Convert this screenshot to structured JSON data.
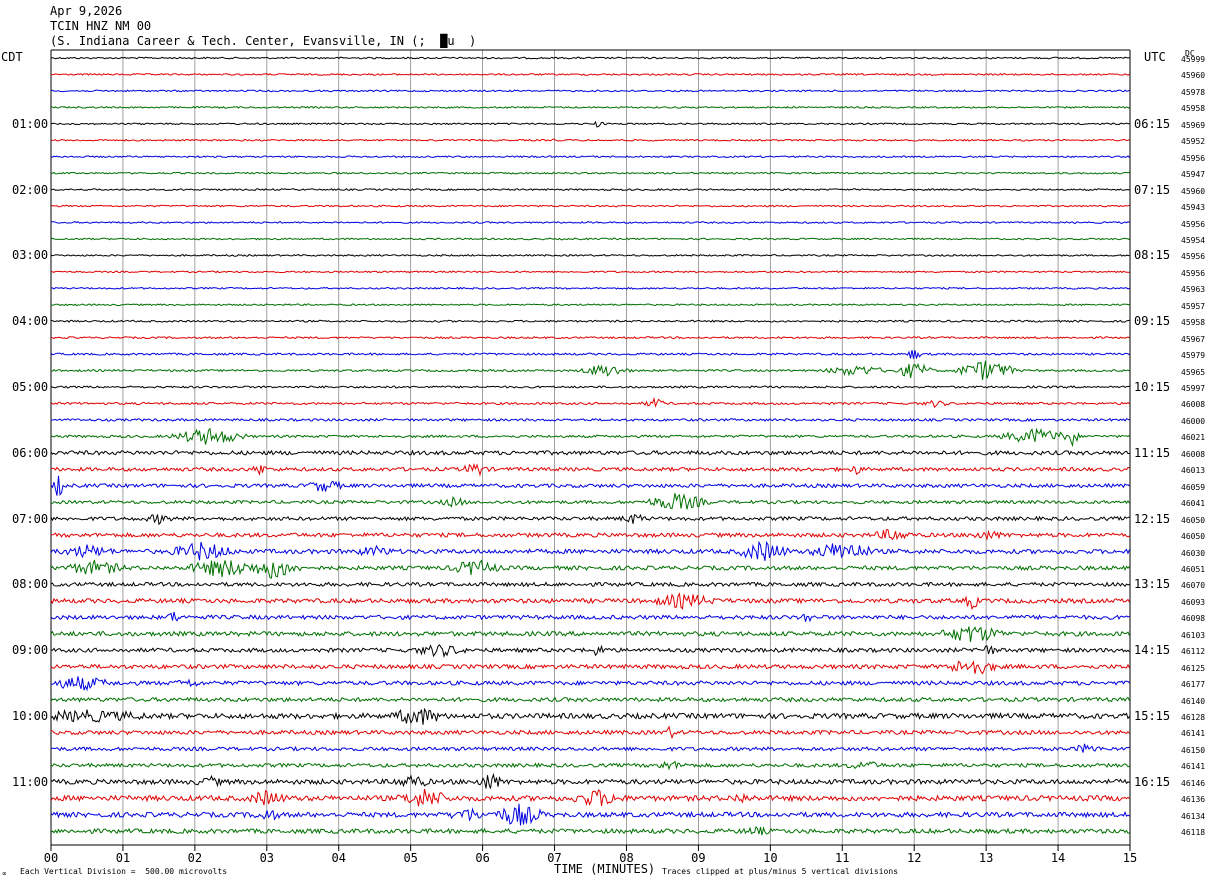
{
  "header": {
    "date": "Apr 9,2026",
    "station": "TCIN HNZ NM 00",
    "location": "(S. Indiana Career & Tech. Center, Evansville, IN (;  █u  )"
  },
  "left_axis_label": "CDT",
  "right_axis_label": "UTC",
  "dc_label": "DC",
  "footer": {
    "scale": "Each Vertical Division =  500.00 microvolts",
    "xlabel": "TIME (MINUTES)",
    "clip_note": "Traces clipped at plus/minus 5 vertical divisions",
    "corner_mark": "∝"
  },
  "chart_data": {
    "type": "line",
    "title": "",
    "xlabel": "TIME (MINUTES)",
    "xlim": [
      0,
      15
    ],
    "x_ticks": [
      "00",
      "01",
      "02",
      "03",
      "04",
      "05",
      "06",
      "07",
      "08",
      "09",
      "10",
      "11",
      "12",
      "13",
      "14",
      "15"
    ],
    "num_traces": 48,
    "trace_colors": [
      "#000000",
      "#e00000",
      "#0000e0",
      "#007000"
    ],
    "cdt_hour_labels": [
      "01:00",
      "02:00",
      "03:00",
      "04:00",
      "05:00",
      "06:00",
      "07:00",
      "08:00",
      "09:00",
      "10:00",
      "11:00"
    ],
    "utc_hour_labels": [
      "06:15",
      "07:15",
      "08:15",
      "09:15",
      "10:15",
      "11:15",
      "12:15",
      "13:15",
      "14:15",
      "15:15",
      "16:15"
    ],
    "dc_offsets": [
      45999,
      45960,
      45978,
      45958,
      45969,
      45952,
      45956,
      45947,
      45960,
      45943,
      45956,
      45954,
      45956,
      45956,
      45963,
      45957,
      45958,
      45967,
      45979,
      45965,
      45997,
      46008,
      46000,
      46021,
      46008,
      46013,
      46059,
      46041,
      46050,
      46050,
      46030,
      46051,
      46070,
      46093,
      46098,
      46103,
      46112,
      46125,
      46177,
      46140,
      46128,
      46141,
      46150,
      46141,
      46146,
      46136,
      46134,
      46118
    ],
    "trace_noise": [
      0.8,
      0.8,
      0.8,
      0.8,
      0.8,
      0.8,
      0.8,
      0.8,
      0.8,
      0.8,
      0.8,
      0.8,
      0.8,
      0.8,
      0.8,
      0.8,
      0.9,
      0.9,
      1.0,
      1.0,
      1.0,
      1.1,
      1.2,
      1.2,
      2.0,
      1.8,
      1.8,
      1.6,
      1.8,
      2.0,
      2.2,
      2.0,
      1.9,
      2.2,
      2.0,
      2.2,
      2.0,
      2.1,
      2.0,
      2.0,
      2.6,
      2.0,
      1.8,
      1.8,
      2.4,
      2.6,
      2.4,
      2.2
    ],
    "events": [
      {
        "trace": 4,
        "minute": 7.6,
        "amp": 3,
        "dur": 0.1
      },
      {
        "trace": 5,
        "minute": 7.0,
        "amp": 2,
        "dur": 0.05
      },
      {
        "trace": 18,
        "minute": 12.0,
        "amp": 7,
        "dur": 0.1
      },
      {
        "trace": 19,
        "minute": 7.7,
        "amp": 6,
        "dur": 0.4
      },
      {
        "trace": 19,
        "minute": 11.2,
        "amp": 5,
        "dur": 0.5
      },
      {
        "trace": 19,
        "minute": 12.0,
        "amp": 8,
        "dur": 0.3
      },
      {
        "trace": 19,
        "minute": 13.0,
        "amp": 10,
        "dur": 0.5
      },
      {
        "trace": 21,
        "minute": 8.4,
        "amp": 4,
        "dur": 0.2
      },
      {
        "trace": 21,
        "minute": 12.3,
        "amp": 3,
        "dur": 0.2
      },
      {
        "trace": 23,
        "minute": 2.2,
        "amp": 8,
        "dur": 0.6
      },
      {
        "trace": 23,
        "minute": 13.7,
        "amp": 7,
        "dur": 0.6
      },
      {
        "trace": 23,
        "minute": 14.2,
        "amp": 10,
        "dur": 0.1
      },
      {
        "trace": 25,
        "minute": 2.9,
        "amp": 6,
        "dur": 0.1
      },
      {
        "trace": 25,
        "minute": 5.9,
        "amp": 6,
        "dur": 0.2
      },
      {
        "trace": 25,
        "minute": 11.2,
        "amp": 4,
        "dur": 0.1
      },
      {
        "trace": 26,
        "minute": 0.1,
        "amp": 10,
        "dur": 0.1
      },
      {
        "trace": 26,
        "minute": 3.8,
        "amp": 5,
        "dur": 0.3
      },
      {
        "trace": 27,
        "minute": 8.7,
        "amp": 8,
        "dur": 0.5
      },
      {
        "trace": 27,
        "minute": 5.6,
        "amp": 4,
        "dur": 0.2
      },
      {
        "trace": 28,
        "minute": 1.5,
        "amp": 4,
        "dur": 0.2
      },
      {
        "trace": 28,
        "minute": 8.1,
        "amp": 4,
        "dur": 0.2
      },
      {
        "trace": 29,
        "minute": 11.7,
        "amp": 5,
        "dur": 0.3
      },
      {
        "trace": 29,
        "minute": 13.0,
        "amp": 3,
        "dur": 0.3
      },
      {
        "trace": 30,
        "minute": 0.5,
        "amp": 5,
        "dur": 0.4
      },
      {
        "trace": 30,
        "minute": 2.1,
        "amp": 8,
        "dur": 0.5
      },
      {
        "trace": 30,
        "minute": 4.5,
        "amp": 4,
        "dur": 0.3
      },
      {
        "trace": 30,
        "minute": 9.9,
        "amp": 9,
        "dur": 0.4
      },
      {
        "trace": 30,
        "minute": 11.0,
        "amp": 9,
        "dur": 0.5
      },
      {
        "trace": 31,
        "minute": 0.6,
        "amp": 6,
        "dur": 0.5
      },
      {
        "trace": 31,
        "minute": 2.4,
        "amp": 8,
        "dur": 0.6
      },
      {
        "trace": 31,
        "minute": 3.1,
        "amp": 10,
        "dur": 0.4
      },
      {
        "trace": 31,
        "minute": 5.9,
        "amp": 7,
        "dur": 0.4
      },
      {
        "trace": 33,
        "minute": 8.8,
        "amp": 6,
        "dur": 0.5
      },
      {
        "trace": 33,
        "minute": 12.8,
        "amp": 9,
        "dur": 0.1
      },
      {
        "trace": 34,
        "minute": 1.7,
        "amp": 5,
        "dur": 0.1
      },
      {
        "trace": 34,
        "minute": 10.5,
        "amp": 5,
        "dur": 0.1
      },
      {
        "trace": 35,
        "minute": 12.8,
        "amp": 8,
        "dur": 0.5
      },
      {
        "trace": 36,
        "minute": 5.4,
        "amp": 5,
        "dur": 0.4
      },
      {
        "trace": 36,
        "minute": 7.6,
        "amp": 4,
        "dur": 0.2
      },
      {
        "trace": 36,
        "minute": 13.0,
        "amp": 4,
        "dur": 0.2
      },
      {
        "trace": 37,
        "minute": 12.8,
        "amp": 8,
        "dur": 0.4
      },
      {
        "trace": 38,
        "minute": 0.4,
        "amp": 6,
        "dur": 0.5
      },
      {
        "trace": 38,
        "minute": 1.9,
        "amp": 3,
        "dur": 0.2
      },
      {
        "trace": 40,
        "minute": 0.5,
        "amp": 4,
        "dur": 1.0
      },
      {
        "trace": 40,
        "minute": 5.1,
        "amp": 8,
        "dur": 0.4
      },
      {
        "trace": 41,
        "minute": 8.6,
        "amp": 5,
        "dur": 0.1
      },
      {
        "trace": 42,
        "minute": 14.4,
        "amp": 4,
        "dur": 0.2
      },
      {
        "trace": 43,
        "minute": 8.6,
        "amp": 3,
        "dur": 0.3
      },
      {
        "trace": 43,
        "minute": 11.3,
        "amp": 3,
        "dur": 0.3
      },
      {
        "trace": 44,
        "minute": 2.2,
        "amp": 4,
        "dur": 0.2
      },
      {
        "trace": 44,
        "minute": 5.0,
        "amp": 5,
        "dur": 0.3
      },
      {
        "trace": 44,
        "minute": 6.1,
        "amp": 8,
        "dur": 0.2
      },
      {
        "trace": 45,
        "minute": 3.0,
        "amp": 6,
        "dur": 0.3
      },
      {
        "trace": 45,
        "minute": 5.2,
        "amp": 8,
        "dur": 0.4
      },
      {
        "trace": 45,
        "minute": 7.6,
        "amp": 7,
        "dur": 0.4
      },
      {
        "trace": 45,
        "minute": 9.6,
        "amp": 3,
        "dur": 0.2
      },
      {
        "trace": 46,
        "minute": 3.0,
        "amp": 5,
        "dur": 0.2
      },
      {
        "trace": 46,
        "minute": 5.8,
        "amp": 5,
        "dur": 0.3
      },
      {
        "trace": 46,
        "minute": 6.5,
        "amp": 10,
        "dur": 0.4
      },
      {
        "trace": 47,
        "minute": 9.8,
        "amp": 3,
        "dur": 0.2
      }
    ]
  }
}
